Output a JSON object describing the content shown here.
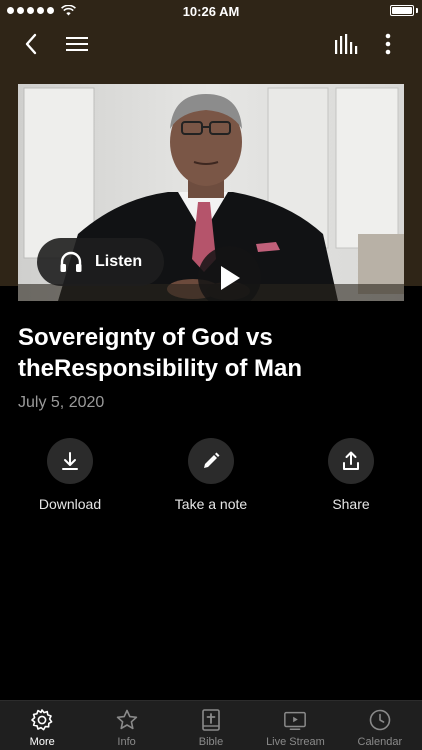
{
  "status_bar": {
    "time": "10:26 AM"
  },
  "nav": {
    "back_icon": "chevron-left-icon",
    "menu_icon": "hamburger-icon",
    "equalizer_icon": "equalizer-icon",
    "more_icon": "more-vertical-icon"
  },
  "media": {
    "listen_label": "Listen",
    "title": "Sovereignty of God vs theResponsibility of Man",
    "date": "July 5, 2020"
  },
  "actions": [
    {
      "label": "Download",
      "icon": "download-icon"
    },
    {
      "label": "Take a note",
      "icon": "pencil-icon"
    },
    {
      "label": "Share",
      "icon": "share-icon"
    }
  ],
  "tabs": [
    {
      "label": "More",
      "icon": "gear-icon",
      "active": true
    },
    {
      "label": "Info",
      "icon": "star-icon",
      "active": false
    },
    {
      "label": "Bible",
      "icon": "bible-icon",
      "active": false
    },
    {
      "label": "Live Stream",
      "icon": "tv-play-icon",
      "active": false
    },
    {
      "label": "Calendar",
      "icon": "clock-icon",
      "active": false
    }
  ],
  "colors": {
    "header_background": "#2f2517",
    "background": "#000000",
    "date_text": "#9a9a9a",
    "tabbar_background": "#1f1f1f"
  }
}
